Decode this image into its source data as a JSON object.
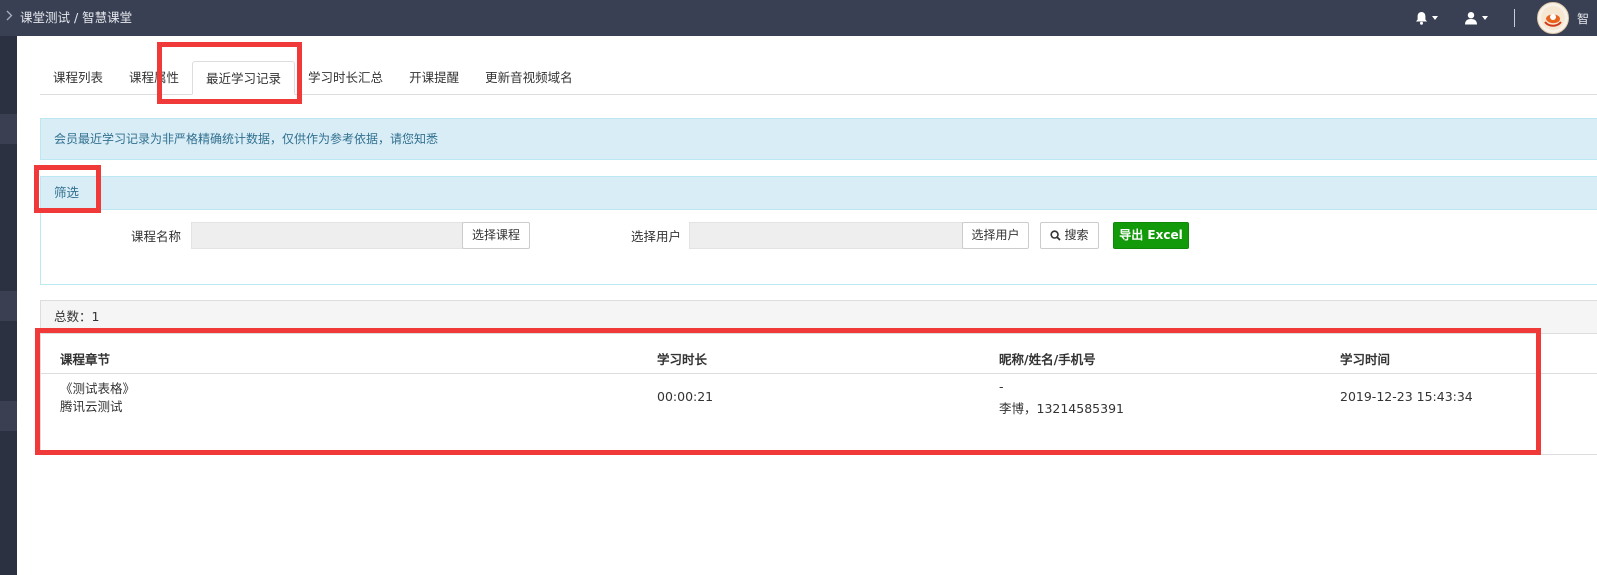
{
  "topbar": {
    "breadcrumb": "课堂测试 / 智慧课堂",
    "user_name": "智"
  },
  "tabs": [
    {
      "label": "课程列表"
    },
    {
      "label": "课程属性"
    },
    {
      "label": "最近学习记录"
    },
    {
      "label": "学习时长汇总"
    },
    {
      "label": "开课提醒"
    },
    {
      "label": "更新音视频域名"
    }
  ],
  "alert": {
    "text": "会员最近学习记录为非严格精确统计数据，仅供作为参考依据，请您知悉"
  },
  "filter": {
    "title": "筛选",
    "course_label": "课程名称",
    "course_value": "",
    "choose_course": "选择课程",
    "user_label": "选择用户",
    "user_value": "",
    "choose_user": "选择用户",
    "search": "搜索",
    "export": "导出 Excel"
  },
  "list": {
    "total": "总数：1",
    "columns": [
      "课程章节",
      "学习时长",
      "昵称/姓名/手机号",
      "学习时间"
    ],
    "rows": [
      {
        "chapter_line1": "《测试表格》",
        "chapter_line2": "腾讯云测试",
        "duration": "00:00:21",
        "nick": "-",
        "name_phone": "李博，13214585391",
        "time": "2019-12-23 15:43:34"
      }
    ]
  },
  "colors": {
    "topbar": "#394053",
    "highlight": "#f03a3a",
    "info_bg": "#d9edf7",
    "export_green": "#139a0b"
  }
}
